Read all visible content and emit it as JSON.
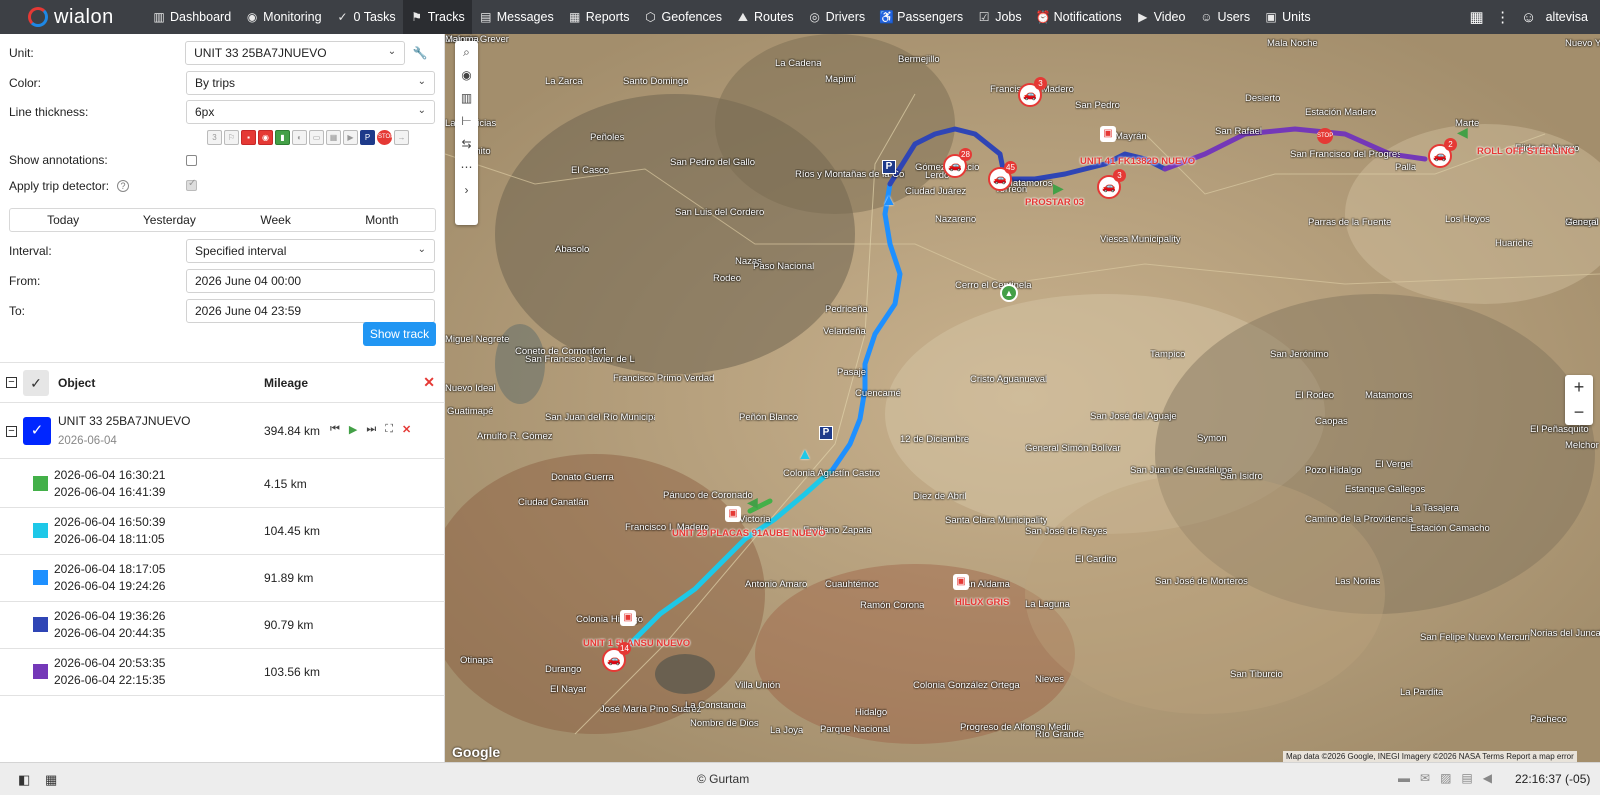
{
  "app": {
    "name": "wialon",
    "user": "altevisa"
  },
  "nav": [
    {
      "icon": "dashboard-icon",
      "glyph": "▥",
      "label": "Dashboard"
    },
    {
      "icon": "monitoring-icon",
      "glyph": "◉",
      "label": "Monitoring"
    },
    {
      "icon": "tasks-icon",
      "glyph": "✓",
      "label": "0   Tasks"
    },
    {
      "icon": "tracks-icon",
      "glyph": "⚑",
      "label": "Tracks",
      "active": true
    },
    {
      "icon": "messages-icon",
      "glyph": "▤",
      "label": "Messages"
    },
    {
      "icon": "reports-icon",
      "glyph": "▦",
      "label": "Reports"
    },
    {
      "icon": "geofences-icon",
      "glyph": "⬡",
      "label": "Geofences"
    },
    {
      "icon": "routes-icon",
      "glyph": "⛰",
      "label": "Routes"
    },
    {
      "icon": "drivers-icon",
      "glyph": "◎",
      "label": "Drivers"
    },
    {
      "icon": "passengers-icon",
      "glyph": "♿",
      "label": "Passengers"
    },
    {
      "icon": "jobs-icon",
      "glyph": "☑",
      "label": "Jobs"
    },
    {
      "icon": "notifications-icon",
      "glyph": "⏰",
      "label": "Notifications"
    },
    {
      "icon": "video-icon",
      "glyph": "▶",
      "label": "Video"
    },
    {
      "icon": "users-icon",
      "glyph": "☺",
      "label": "Users"
    },
    {
      "icon": "units-icon",
      "glyph": "▣",
      "label": "Units"
    }
  ],
  "form": {
    "unit_label": "Unit:",
    "unit_value": "UNIT 33 25BA7JNUEVO",
    "color_label": "Color:",
    "color_value": "By trips",
    "thickness_label": "Line thickness:",
    "thickness_value": "6px",
    "annotations_label": "Show annotations:",
    "trip_detector_label": "Apply trip detector:",
    "periods": [
      "Today",
      "Yesterday",
      "Week",
      "Month"
    ],
    "interval_label": "Interval:",
    "interval_value": "Specified interval",
    "from_label": "From:",
    "from_value": "2026 June 04 00:00",
    "to_label": "To:",
    "to_value": "2026 June 04 23:59",
    "show_track": "Show track"
  },
  "table": {
    "col_object": "Object",
    "col_mileage": "Mileage",
    "unit": {
      "name": "UNIT 33 25BA7JNUEVO",
      "date": "2026-06-04",
      "mileage": "394.84 km"
    },
    "trips": [
      {
        "start": "2026-06-04 16:30:21",
        "end": "2026-06-04 16:41:39",
        "mileage": "4.15 km",
        "color": "#43b049"
      },
      {
        "start": "2026-06-04 16:50:39",
        "end": "2026-06-04 18:11:05",
        "mileage": "104.45 km",
        "color": "#1ec8e8"
      },
      {
        "start": "2026-06-04 18:17:05",
        "end": "2026-06-04 19:24:26",
        "mileage": "91.89 km",
        "color": "#1e90ff"
      },
      {
        "start": "2026-06-04 19:36:26",
        "end": "2026-06-04 20:44:35",
        "mileage": "90.79 km",
        "color": "#2f45b5"
      },
      {
        "start": "2026-06-04 20:53:35",
        "end": "2026-06-04 22:15:35",
        "mileage": "103.56 km",
        "color": "#7438b8"
      }
    ]
  },
  "map": {
    "places": [
      "La Cadena",
      "Bermejillo",
      "Mapimí",
      "Francisco I. Madero",
      "San Pedro",
      "Desierto",
      "Mala Noche",
      "Nuevo Yucatán",
      "La Zarca",
      "Santo Domingo",
      "Peñoles",
      "Las Delicias",
      "Palmito",
      "El Casco",
      "San Pedro del Gallo",
      "San Luis del Cordero",
      "Ríos y Montañas de la Comarca Lagunera",
      "Gómez Palacio",
      "Lerdo",
      "Ciudad Juárez",
      "Torreón",
      "Matamoros",
      "Nazareno",
      "Viesca Municipality",
      "Mayrán",
      "San Rafael",
      "Estación Madero",
      "San Francisco del Progreso",
      "Parras de la Fuente",
      "Palla",
      "Marte",
      "Ejido de Nuevo",
      "Los Hoyos",
      "Huariche",
      "Macuyú",
      "General Cepeda",
      "Abasolo",
      "Rodeo",
      "Nazas",
      "Paso Nacional",
      "Pedriceña",
      "Velardeña",
      "Cerro el Centinela",
      "Miguel Negrete",
      "Coneto de Comonfort",
      "San Francisco Javier de Lajas",
      "Francisco Primo Verdad",
      "Pasaje",
      "Cuencamé",
      "Peñón Blanco",
      "San Juan del Río Municipality",
      "Nuevo Ideal",
      "Guatimapé",
      "Arnulfo R. Gómez",
      "Donato Guerra",
      "Ciudad Canatlán",
      "Pánuco de Coronado",
      "Colonia Agustín Castro",
      "12 de Diciembre",
      "Diez de Abril",
      "Emiliano Zapata",
      "Francisco I. Madero",
      "Victoria",
      "Santa Clara Municipality",
      "San José de Reyes",
      "Antonio Amaro",
      "Cuauhtémoc",
      "Juan Aldama",
      "Ramón Corona",
      "La Laguna",
      "Colonia Hidalgo",
      "Durango",
      "Otinapa",
      "El Nayar",
      "José María Pino Suárez",
      "La Constancia",
      "Villa Unión",
      "Nombre de Dios",
      "La Joya",
      "Hidalgo",
      "Colonia González Ortega",
      "Parque Nacional",
      "Progreso de Alfonso Medina",
      "Nieves",
      "Río Grande",
      "Tampico",
      "San Jerónimo",
      "Cristo Aguanueval",
      "General Simón Bolívar",
      "San José del Aguaje",
      "Symon",
      "El Rodeo",
      "Matamoros",
      "Caopas",
      "San Juan de Guadalupe",
      "Pozo Hidalgo",
      "San Isidro",
      "Estanque Gallegos",
      "El Vergel",
      "El Peñasquito",
      "Melchor Ocampo",
      "Camino de la Providencia",
      "La Tasajera",
      "Estación Camacho",
      "El Cardito",
      "San José de Morteros",
      "Las Norias",
      "San Felipe Nuevo Mercurio",
      "Norias del Juncal",
      "San Tiburcio",
      "La Pardita",
      "Pacheco",
      "Colonia Grever",
      "Majoma"
    ],
    "unit_labels": [
      "UNIT 41 FK1382D NUEVO",
      "PROSTAR 03",
      "ROLL OFF STERLING",
      "UNIT 29 PLACAS 91AUBE NUEVO",
      "HILUX GRIS",
      "UNIT 1 5LANSU NUEVO"
    ],
    "cluster_counts": [
      "3",
      "28",
      "45",
      "3",
      "2",
      "14"
    ],
    "parking": [
      "P",
      "P",
      "P"
    ],
    "google": "Google",
    "attribution": "Map data ©2026 Google, INEGI Imagery ©2026 NASA   Terms   Report a map error"
  },
  "footer": {
    "copyright": "© Gurtam",
    "time": "22:16:37 (-05)"
  }
}
